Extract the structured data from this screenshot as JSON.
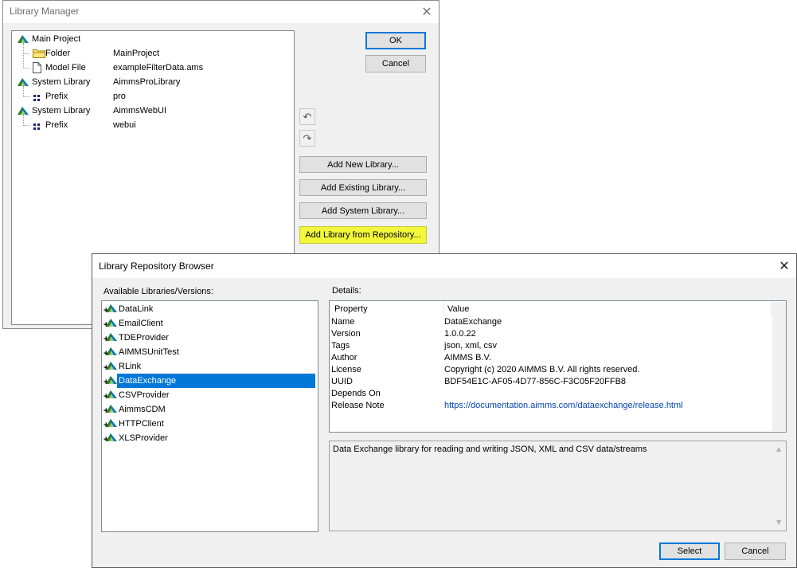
{
  "library_manager": {
    "title": "Library Manager",
    "tree": [
      {
        "label": "Main Project",
        "value": "",
        "icon": "aimms-icon",
        "level": 0
      },
      {
        "label": "Folder",
        "value": "MainProject",
        "icon": "folder-icon",
        "level": 1
      },
      {
        "label": "Model File",
        "value": "exampleFilterData.ams",
        "icon": "file-icon",
        "level": 1
      },
      {
        "label": "System Library",
        "value": "AimmsProLibrary",
        "icon": "aimms-icon",
        "level": 0
      },
      {
        "label": "Prefix",
        "value": "pro",
        "icon": "dots-icon",
        "level": 1
      },
      {
        "label": "System Library",
        "value": "AimmsWebUI",
        "icon": "aimms-icon",
        "level": 0
      },
      {
        "label": "Prefix",
        "value": "webui",
        "icon": "dots-icon",
        "level": 1
      }
    ],
    "ok_label": "OK",
    "cancel_label": "Cancel",
    "undo_icon": "↶",
    "redo_icon": "↷",
    "add_new_label": "Add New Library...",
    "add_existing_label": "Add Existing Library...",
    "add_system_label": "Add System Library...",
    "add_repo_label": "Add Library from Repository..."
  },
  "repo_browser": {
    "title": "Library Repository Browser",
    "available_label": "Available Libraries/Versions:",
    "details_label": "Details:",
    "libraries": [
      "DataLink",
      "EmailClient",
      "TDEProvider",
      "AIMMSUnitTest",
      "RLink",
      "DataExchange",
      "CSVProvider",
      "AimmsCDM",
      "HTTPClient",
      "XLSProvider"
    ],
    "selected_library": "DataExchange",
    "details_columns": {
      "property": "Property",
      "value": "Value"
    },
    "details": [
      {
        "property": "Name",
        "value": "DataExchange"
      },
      {
        "property": "Version",
        "value": "1.0.0.22"
      },
      {
        "property": "Tags",
        "value": "json, xml, csv"
      },
      {
        "property": "Author",
        "value": "AIMMS B.V."
      },
      {
        "property": "License",
        "value": "Copyright (c) 2020 AIMMS B.V. All rights reserved."
      },
      {
        "property": "UUID",
        "value": "BDF54E1C-AF05-4D77-856C-F3C05F20FFB8"
      },
      {
        "property": "Depends On",
        "value": ""
      },
      {
        "property": "Release Note",
        "value": "https://documentation.aimms.com/dataexchange/release.html"
      }
    ],
    "description": "Data Exchange library for reading and writing JSON, XML and CSV data/streams",
    "select_label": "Select",
    "cancel_label": "Cancel"
  },
  "colors": {
    "selection": "#0078d7",
    "highlight": "#f2f73a",
    "link": "#0645ad"
  }
}
